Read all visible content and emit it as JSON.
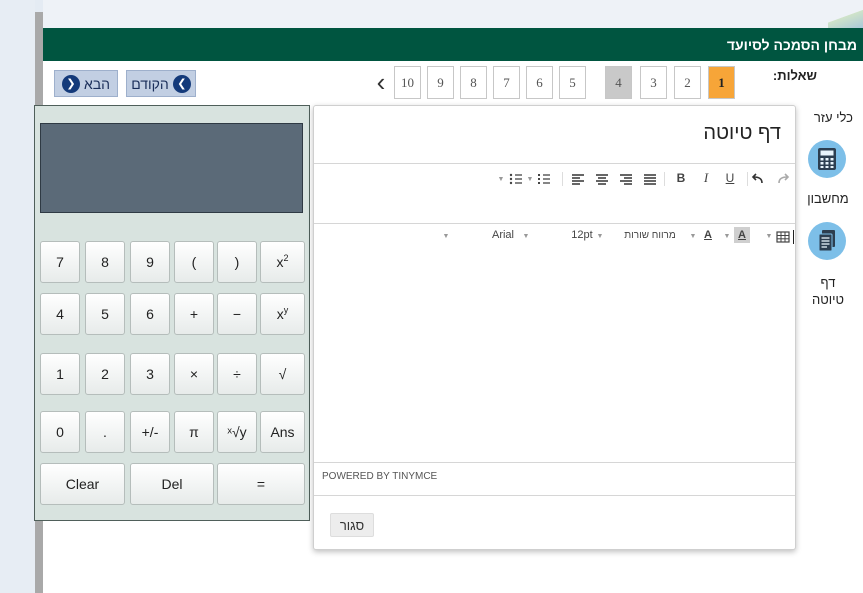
{
  "header": {
    "title": "מבחן הסמכה לסיועד"
  },
  "nav": {
    "next_label": "הבא",
    "prev_label": "הקודם"
  },
  "questions": {
    "label": "שאלות:",
    "numbers": [
      "1",
      "2",
      "3",
      "4",
      "5",
      "6",
      "7",
      "8",
      "9",
      "10"
    ],
    "current": "1"
  },
  "tools": {
    "title": "כלי עזר",
    "calculator_label": "מחשבון",
    "draft_label_line1": "דף",
    "draft_label_line2": "טיוטה"
  },
  "calculator": {
    "display": "",
    "keys": {
      "k7": "7",
      "k8": "8",
      "k9": "9",
      "lparen": "(",
      "rparen": ")",
      "sq": "x",
      "sq_sup": "2",
      "k4": "4",
      "k5": "5",
      "k6": "6",
      "plus": "+",
      "minus": "−",
      "pow": "x",
      "pow_sup": "y",
      "k1": "1",
      "k2": "2",
      "k3": "3",
      "mul": "×",
      "div": "÷",
      "sqrt": "√",
      "k0": "0",
      "dot": ".",
      "neg": "+/-",
      "pi": "π",
      "root": "ˣ√y",
      "ans": "Ans",
      "clear": "Clear",
      "del": "Del",
      "eq": "="
    }
  },
  "draft": {
    "title": "דף טיוטה",
    "font_family": "Arial",
    "font_size": "12pt",
    "line_spacing": "מרווח שורות",
    "bold": "B",
    "italic": "I",
    "underline": "U",
    "font_color": "A",
    "bg_color": "A",
    "content": "",
    "powered_by": "POWERED BY TINYMCE",
    "close_label": "סגור"
  }
}
